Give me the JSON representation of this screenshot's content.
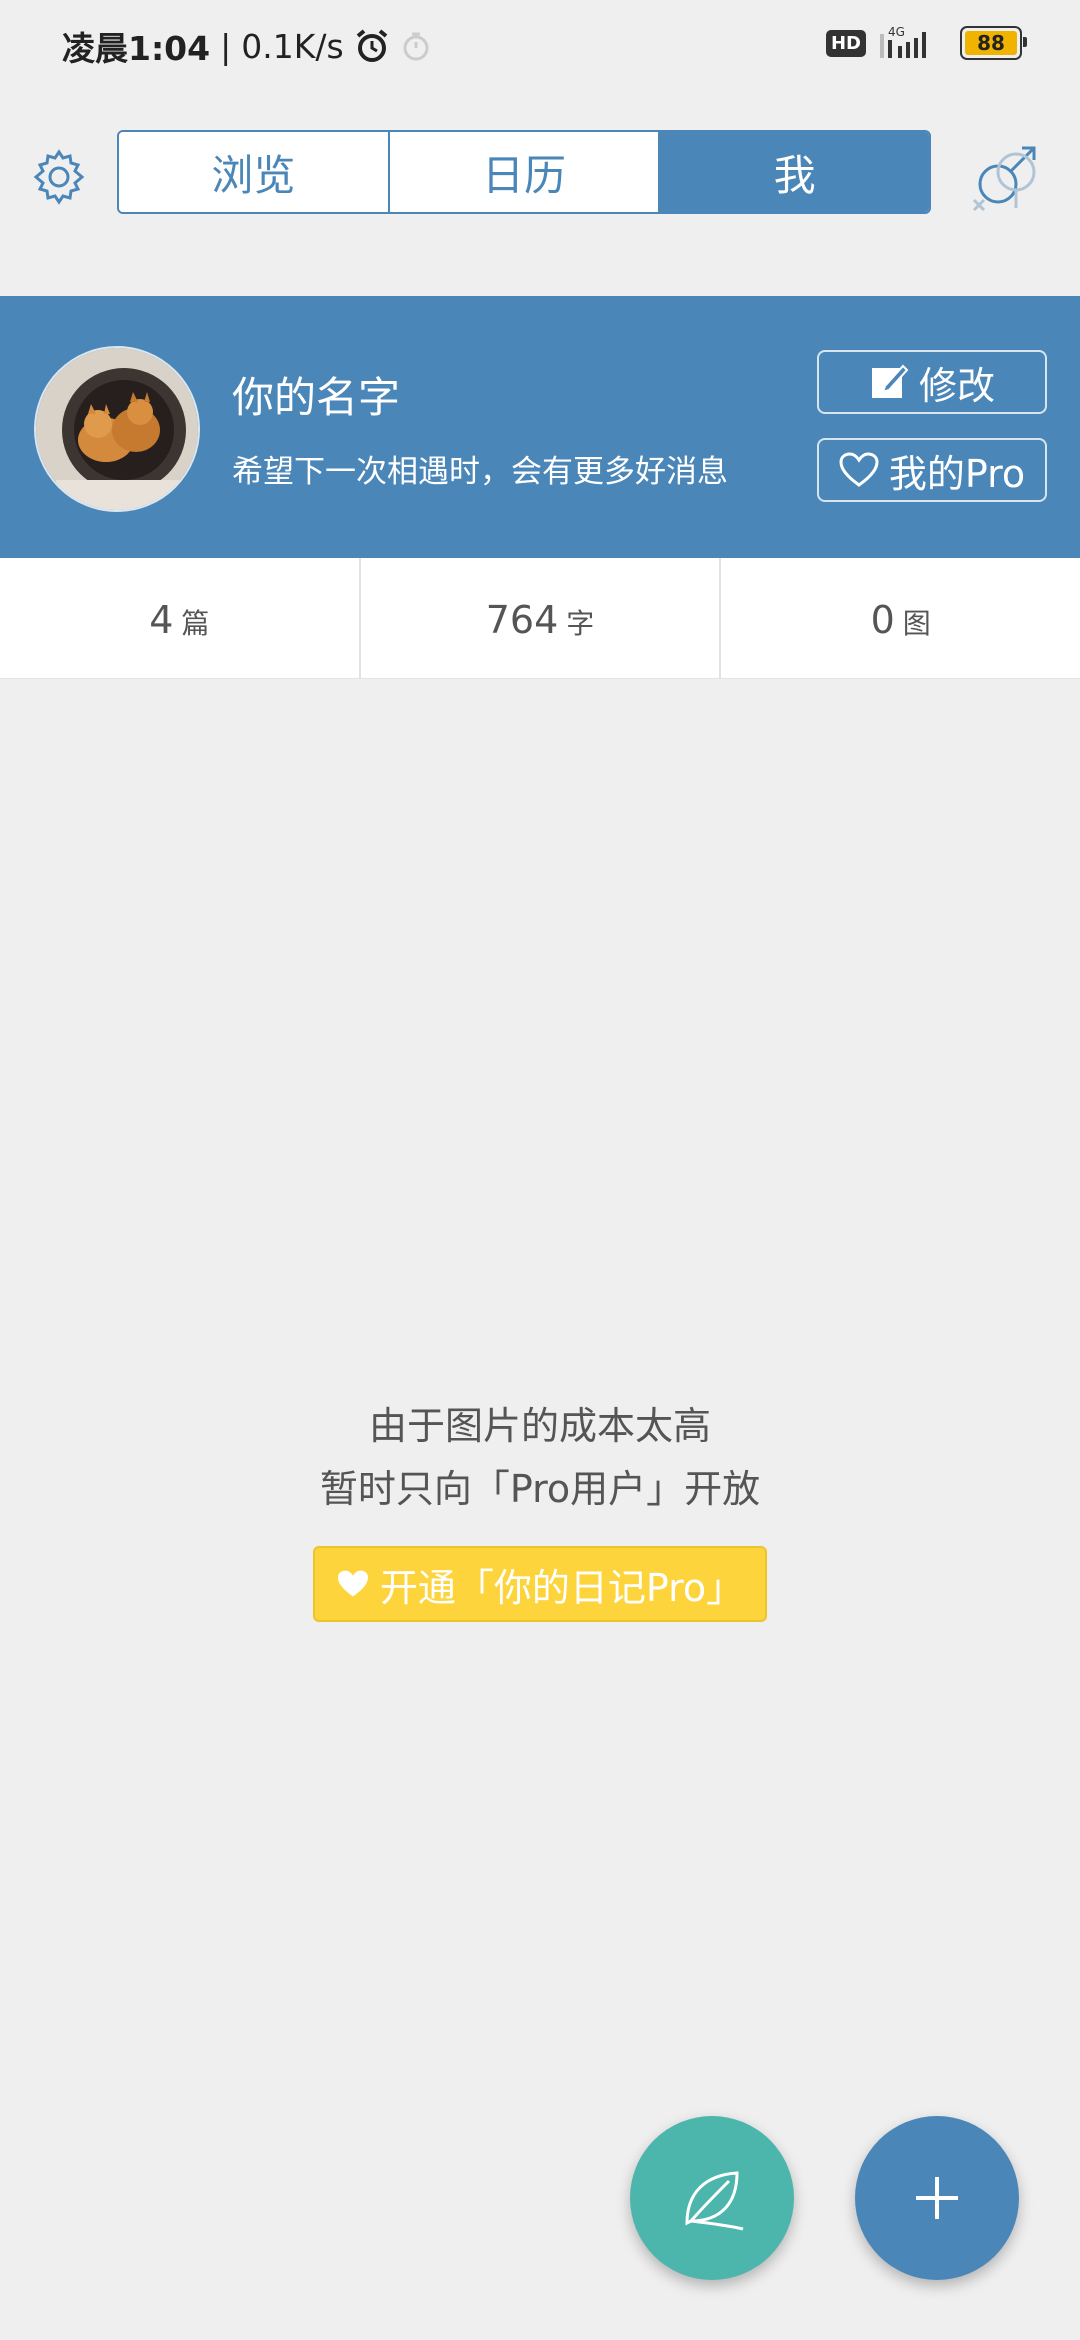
{
  "status_bar": {
    "time": "凌晨1:04",
    "separator": "|",
    "net_speed": "0.1K/s",
    "hd_label": "HD",
    "network_label": "4G",
    "battery": "88"
  },
  "tabs": [
    {
      "label": "浏览",
      "active": false
    },
    {
      "label": "日历",
      "active": false
    },
    {
      "label": "我",
      "active": true
    }
  ],
  "profile": {
    "name": "你的名字",
    "bio": "希望下一次相遇时，会有更多好消息",
    "edit_label": "修改",
    "pro_label": "我的Pro"
  },
  "stats": [
    {
      "value": "4",
      "unit": "篇"
    },
    {
      "value": "764",
      "unit": "字"
    },
    {
      "value": "0",
      "unit": "图"
    }
  ],
  "message": {
    "line1": "由于图片的成本太高",
    "line2": "暂时只向「Pro用户」开放",
    "cta_label": "开通「你的日记Pro」"
  },
  "colors": {
    "primary": "#4a86b8",
    "accent_yellow": "#fdd43c",
    "leaf_fab": "#4db6ac",
    "background": "#efefef"
  },
  "icons": [
    "gear-icon",
    "gender-icon",
    "edit-icon",
    "heart-icon",
    "leaf-icon",
    "plus-icon",
    "alarm-icon",
    "timer-icon",
    "signal-icon"
  ]
}
